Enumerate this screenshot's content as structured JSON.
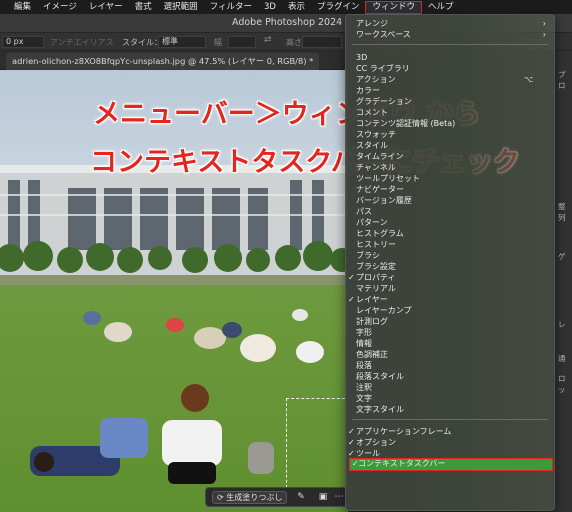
{
  "menubar": {
    "items": [
      "編集",
      "イメージ",
      "レイヤー",
      "書式",
      "選択範囲",
      "フィルター",
      "3D",
      "表示",
      "プラグイン",
      "ウィンドウ",
      "ヘルプ"
    ],
    "active": "ウィンドウ"
  },
  "app": {
    "title": "Adobe Photoshop 2024"
  },
  "options": {
    "size_value": "0 px",
    "antialias": "アンチエイリアス",
    "style_label": "スタイル：",
    "style_value": "標準",
    "width_label": "幅",
    "height_label": "高さ"
  },
  "document_tab": {
    "label": "adrien-olichon-z8XO8BfqpYc-unsplash.jpg @ 47.5% (レイヤー 0, RGB/8) *"
  },
  "overlay": {
    "line1": "メニューバー＞ウィンドウ から",
    "line2": "コンテキストタスクバーにチェック"
  },
  "window_menu": {
    "top_items": [
      {
        "label": "アレンジ",
        "submenu": true
      },
      {
        "label": "ワークスペース",
        "submenu": true
      }
    ],
    "items": [
      {
        "label": "3D",
        "checked": false
      },
      {
        "label": "CC ライブラリ",
        "checked": false
      },
      {
        "label": "アクション",
        "checked": false,
        "shortcut": "⌥"
      },
      {
        "label": "カラー",
        "checked": false
      },
      {
        "label": "グラデーション",
        "checked": false
      },
      {
        "label": "コメント",
        "checked": false
      },
      {
        "label": "コンテンツ認証情報 (Beta)",
        "checked": false
      },
      {
        "label": "スウォッチ",
        "checked": false
      },
      {
        "label": "スタイル",
        "checked": false
      },
      {
        "label": "タイムライン",
        "checked": false
      },
      {
        "label": "チャンネル",
        "checked": false
      },
      {
        "label": "ツールプリセット",
        "checked": false
      },
      {
        "label": "ナビゲーター",
        "checked": false
      },
      {
        "label": "バージョン履歴",
        "checked": false
      },
      {
        "label": "パス",
        "checked": false
      },
      {
        "label": "パターン",
        "checked": false
      },
      {
        "label": "ヒストグラム",
        "checked": false
      },
      {
        "label": "ヒストリー",
        "checked": false
      },
      {
        "label": "ブラシ",
        "checked": false
      },
      {
        "label": "ブラシ設定",
        "checked": false
      },
      {
        "label": "プロパティ",
        "checked": true
      },
      {
        "label": "マテリアル",
        "checked": false
      },
      {
        "label": "レイヤー",
        "checked": true
      },
      {
        "label": "レイヤーカンプ",
        "checked": false
      },
      {
        "label": "計測ログ",
        "checked": false
      },
      {
        "label": "字形",
        "checked": false
      },
      {
        "label": "情報",
        "checked": false
      },
      {
        "label": "色調補正",
        "checked": false
      },
      {
        "label": "段落",
        "checked": false
      },
      {
        "label": "段落スタイル",
        "checked": false
      },
      {
        "label": "注釈",
        "checked": false
      },
      {
        "label": "文字",
        "checked": false
      },
      {
        "label": "文字スタイル",
        "checked": false
      }
    ],
    "bottom_items": [
      {
        "label": "アプリケーションフレーム",
        "checked": true
      },
      {
        "label": "オプション",
        "checked": true
      },
      {
        "label": "ツール",
        "checked": true
      },
      {
        "label": "コンテキストタスクバー",
        "checked": true,
        "highlighted": true
      }
    ]
  },
  "context_taskbar": {
    "generative_fill": "生成塗りつぶし"
  },
  "right_panel": {
    "labels": [
      "プロ",
      "整列",
      "ゲ",
      "レ",
      "通",
      "ロッ"
    ]
  },
  "colors": {
    "accent_red": "#e0261f",
    "highlight_green": "#3a9a3c",
    "menubar_bg": "#1c1c1e"
  }
}
